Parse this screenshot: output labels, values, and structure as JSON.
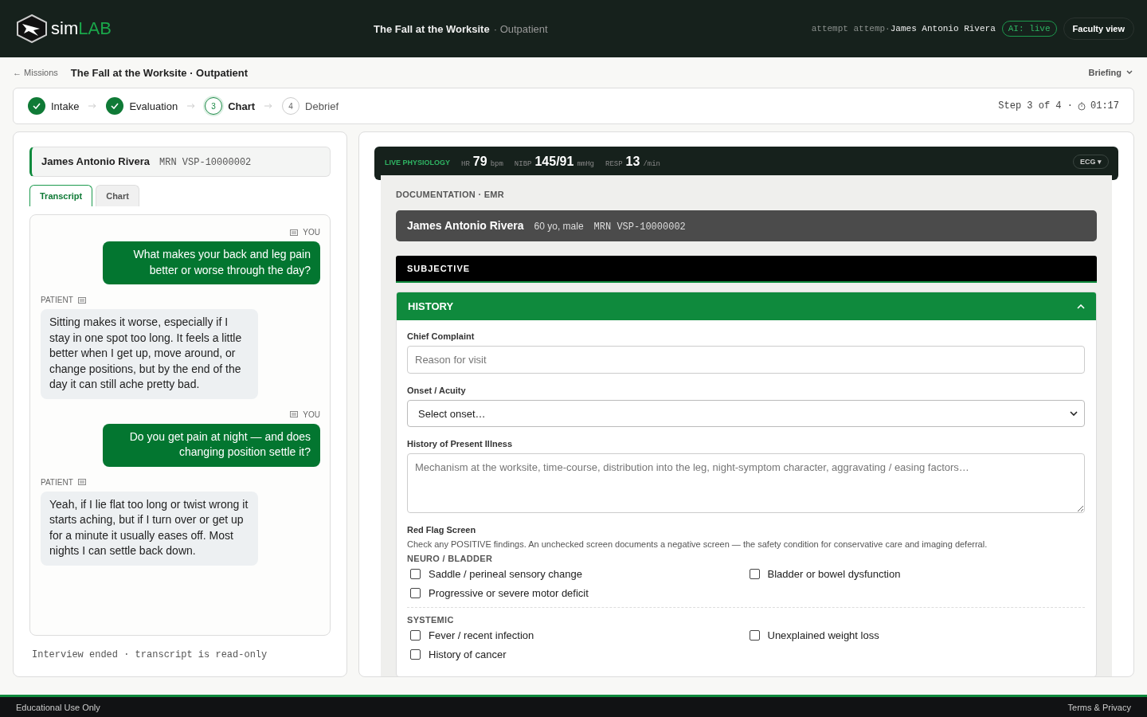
{
  "header": {
    "logo": {
      "prefix": "sim",
      "suffix": "LAB"
    },
    "title": "The Fall at the Worksite",
    "subtitle": "· Outpatient",
    "attempt": "attempt attemp·",
    "user": "James Antonio Rivera",
    "ai_badge": "AI: live",
    "faculty_button": "Faculty view"
  },
  "breadcrumb": {
    "back": "← Missions",
    "title": "The Fall at the Worksite · Outpatient",
    "briefing": "Briefing"
  },
  "steps": [
    {
      "label": "Intake",
      "done": true,
      "selected": false
    },
    {
      "label": "Evaluation",
      "done": true,
      "selected": false
    },
    {
      "number": "3",
      "label": "Chart",
      "done": false,
      "selected": true
    },
    {
      "number": "4",
      "label": "Debrief",
      "done": false,
      "selected": false
    }
  ],
  "step_info": {
    "text": "Step 3 of 4 ·",
    "timer": "01:17"
  },
  "left": {
    "patient": {
      "name": "James Antonio Rivera",
      "mrn": "MRN VSP-10000002"
    },
    "tabs": [
      {
        "label": "Transcript",
        "selected": true
      },
      {
        "label": "Chart",
        "selected": false
      }
    ],
    "messages": [
      {
        "kind": "clinician",
        "speaker": "YOU",
        "text": "What makes your back and leg pain better or worse through the day?"
      },
      {
        "kind": "patient",
        "speaker": "PATIENT",
        "text": "Sitting makes it worse, especially if I stay in one spot too long. It feels a little better when I get up, move around, or change positions, but by the end of the day it can still ache pretty bad."
      },
      {
        "kind": "clinician",
        "speaker": "YOU",
        "text": "Do you get pain at night — and does changing position settle it?"
      },
      {
        "kind": "patient",
        "speaker": "PATIENT",
        "text": "Yeah, if I lie flat too long or twist wrong it starts aching, but if I turn over or get up for a minute it usually eases off. Most nights I can settle back down."
      }
    ],
    "footer_note": "Interview ended · transcript is read-only"
  },
  "physiology": {
    "label": "LIVE PHYSIOLOGY",
    "readings": [
      {
        "label": "HR",
        "value": "79",
        "unit": "bpm"
      },
      {
        "label": "NIBP",
        "value": "145/91",
        "unit": "mmHg"
      },
      {
        "label": "RESP",
        "value": "13",
        "unit": "/min"
      }
    ],
    "ecg_button": "ECG ▾"
  },
  "emr": {
    "heading": "DOCUMENTATION · EMR",
    "patient": {
      "name": "James Antonio Rivera",
      "demographics": "60 yo, male",
      "mrn": "MRN VSP-10000002"
    },
    "section": "SUBJECTIVE",
    "panel": {
      "title": "HISTORY",
      "expanded": true
    },
    "chief_complaint": {
      "label": "Chief Complaint",
      "placeholder": "Reason for visit"
    },
    "onset": {
      "label": "Onset / Acuity",
      "value": "Select onset…"
    },
    "hpi": {
      "label": "History of Present Illness",
      "placeholder": "Mechanism at the worksite, time-course, distribution into the leg, night-symptom character, aggravating / easing factors…"
    },
    "red_flags": {
      "label": "Red Flag Screen",
      "note": "Check any POSITIVE findings. An unchecked screen documents a negative screen — the safety condition for conservative care and imaging deferral.",
      "groups": [
        {
          "title": "NEURO / BLADDER",
          "items": [
            {
              "label": "Saddle / perineal sensory change",
              "checked": false
            },
            {
              "label": "Bladder or bowel dysfunction",
              "checked": false
            },
            {
              "label": "Progressive or severe motor deficit",
              "checked": false
            }
          ]
        },
        {
          "title": "SYSTEMIC",
          "items": [
            {
              "label": "Fever / recent infection",
              "checked": false
            },
            {
              "label": "Unexplained weight loss",
              "checked": false
            },
            {
              "label": "History of cancer",
              "checked": false
            }
          ]
        }
      ]
    }
  },
  "footer": {
    "left": "Educational Use Only",
    "right": "Terms & Privacy"
  }
}
